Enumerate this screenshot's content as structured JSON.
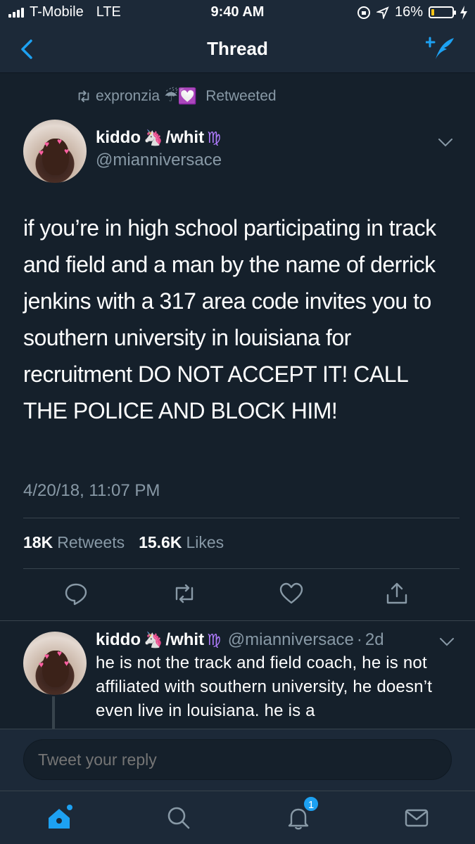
{
  "status_bar": {
    "carrier": "T-Mobile",
    "network": "LTE",
    "time": "9:40 AM",
    "battery_percent": "16%",
    "battery_level": 0.16
  },
  "nav": {
    "title": "Thread"
  },
  "retweet": {
    "user": "expronzia",
    "user_emoji": "☔💟",
    "label": "Retweeted"
  },
  "tweet": {
    "author_name": "kiddo",
    "author_emoji": "🦄",
    "author_name_suffix": "/whit",
    "author_sign": "♍",
    "handle": "@mianniversace",
    "text": "if you’re in high school participating in track and field and a man by the name of derrick jenkins with a 317 area code invites you to southern university in louisiana for recruitment DO NOT ACCEPT IT! CALL THE POLICE AND BLOCK HIM!",
    "timestamp": "4/20/18, 11:07 PM",
    "retweets_count": "18K",
    "retweets_label": "Retweets",
    "likes_count": "15.6K",
    "likes_label": "Likes"
  },
  "reply": {
    "author_name": "kiddo",
    "author_emoji": "🦄",
    "author_name_suffix": "/whit",
    "author_sign": "♍",
    "handle": "@mianniversace",
    "separator": "·",
    "age": "2d",
    "text": "he is not the track and field coach, he is not affiliated with southern university, he doesn’t even live in louisiana. he is a"
  },
  "reply_box": {
    "placeholder": "Tweet your reply"
  },
  "tab_bar": {
    "notifications_badge": "1"
  },
  "colors": {
    "background": "#15202b",
    "bar": "#1c2938",
    "accent": "#1da1f2",
    "muted": "#8899a6",
    "divider": "#38444d"
  }
}
